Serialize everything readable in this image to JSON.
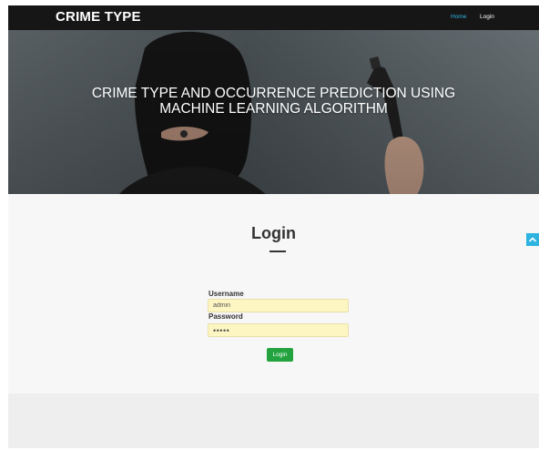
{
  "navbar": {
    "brand": "CRIME TYPE",
    "links": [
      {
        "label": "Home",
        "active": true
      },
      {
        "label": "Login",
        "active": false
      }
    ]
  },
  "hero": {
    "title_line1": "CRIME TYPE AND OCCURRENCE PREDICTION USING",
    "title_line2": "MACHINE LEARNING ALGORITHM"
  },
  "login": {
    "title": "Login",
    "username_label": "Username",
    "username_value": "admin",
    "password_label": "Password",
    "password_value": "•••••",
    "button_label": "Login"
  },
  "icons": {
    "scroll_top": "chevron-up-icon"
  },
  "colors": {
    "navbar_bg": "#161616",
    "accent": "#2db3e0",
    "button_green": "#22a33f",
    "input_bg": "#fdf6c3"
  }
}
